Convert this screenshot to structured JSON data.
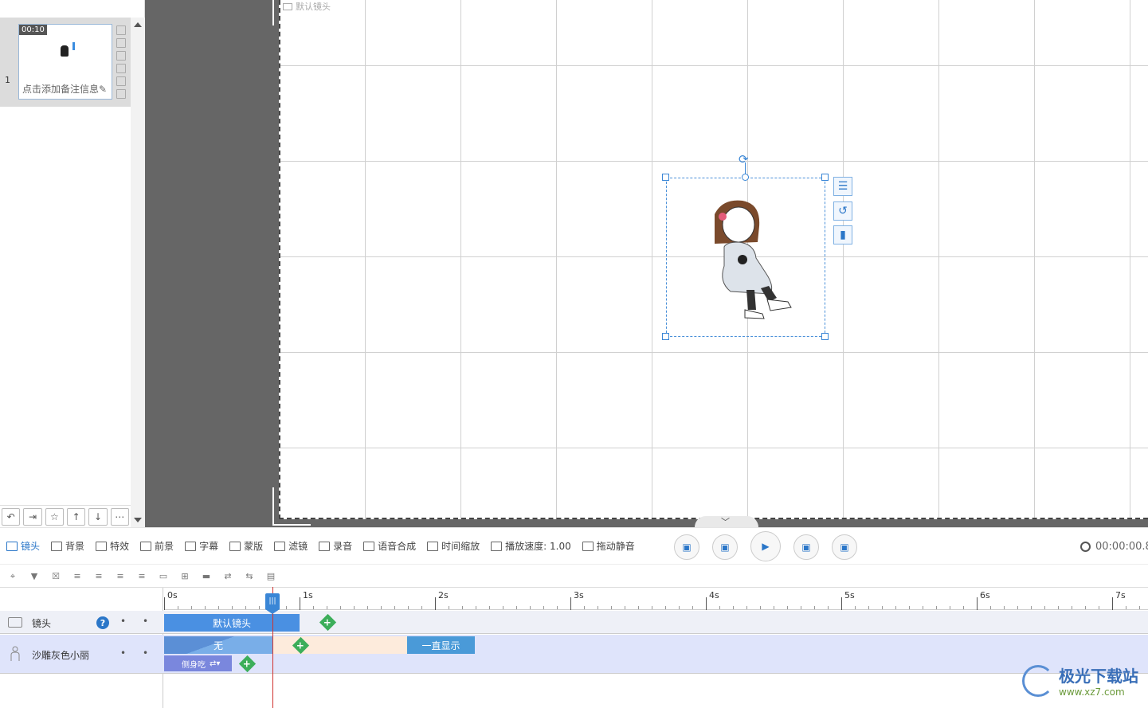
{
  "slide_panel": {
    "slide_number": "1",
    "thumb_time": "00:10",
    "thumb_note": "点击添加备注信息",
    "toolbar_icons": [
      "undo-icon",
      "export-icon",
      "star-icon",
      "arrow-up-icon",
      "arrow-down-icon",
      "more-icon"
    ]
  },
  "canvas": {
    "camera_label": "默认镜头",
    "character_name": "沙雕灰色小丽",
    "object_tools": [
      "align-icon",
      "replace-icon",
      "delete-icon"
    ]
  },
  "toolbar": {
    "tabs": [
      {
        "label": "镜头",
        "icon": "camera-icon",
        "active": true
      },
      {
        "label": "背景",
        "icon": "background-icon",
        "active": false
      },
      {
        "label": "特效",
        "icon": "effects-icon",
        "active": false
      },
      {
        "label": "前景",
        "icon": "foreground-icon",
        "active": false
      },
      {
        "label": "字幕",
        "icon": "subtitle-icon",
        "active": false
      },
      {
        "label": "蒙版",
        "icon": "mask-icon",
        "active": false
      },
      {
        "label": "滤镜",
        "icon": "filter-icon",
        "active": false
      },
      {
        "label": "录音",
        "icon": "microphone-icon",
        "active": false
      },
      {
        "label": "语音合成",
        "icon": "tts-icon",
        "active": false
      },
      {
        "label": "时间缩放",
        "icon": "time-scale-icon",
        "active": false
      },
      {
        "label": "播放速度: 1.00",
        "icon": "speed-icon",
        "active": false
      },
      {
        "label": "拖动静音",
        "icon": "mute-icon",
        "active": false
      }
    ],
    "time_display": "00:00:00.8"
  },
  "timeline": {
    "ticks": [
      "0s",
      "1s",
      "2s",
      "3s",
      "4s",
      "5s",
      "6s",
      "7s"
    ],
    "playhead_seconds": 0.8,
    "tracks": {
      "camera": {
        "name": "镜头",
        "help": "?",
        "clip": "默认镜头"
      },
      "character": {
        "name": "沙雕灰色小丽",
        "entry": "无",
        "exit": "一直显示",
        "action": "侧身吃"
      }
    }
  },
  "watermark": {
    "name": "极光下载站",
    "url": "www.xz7.com"
  }
}
